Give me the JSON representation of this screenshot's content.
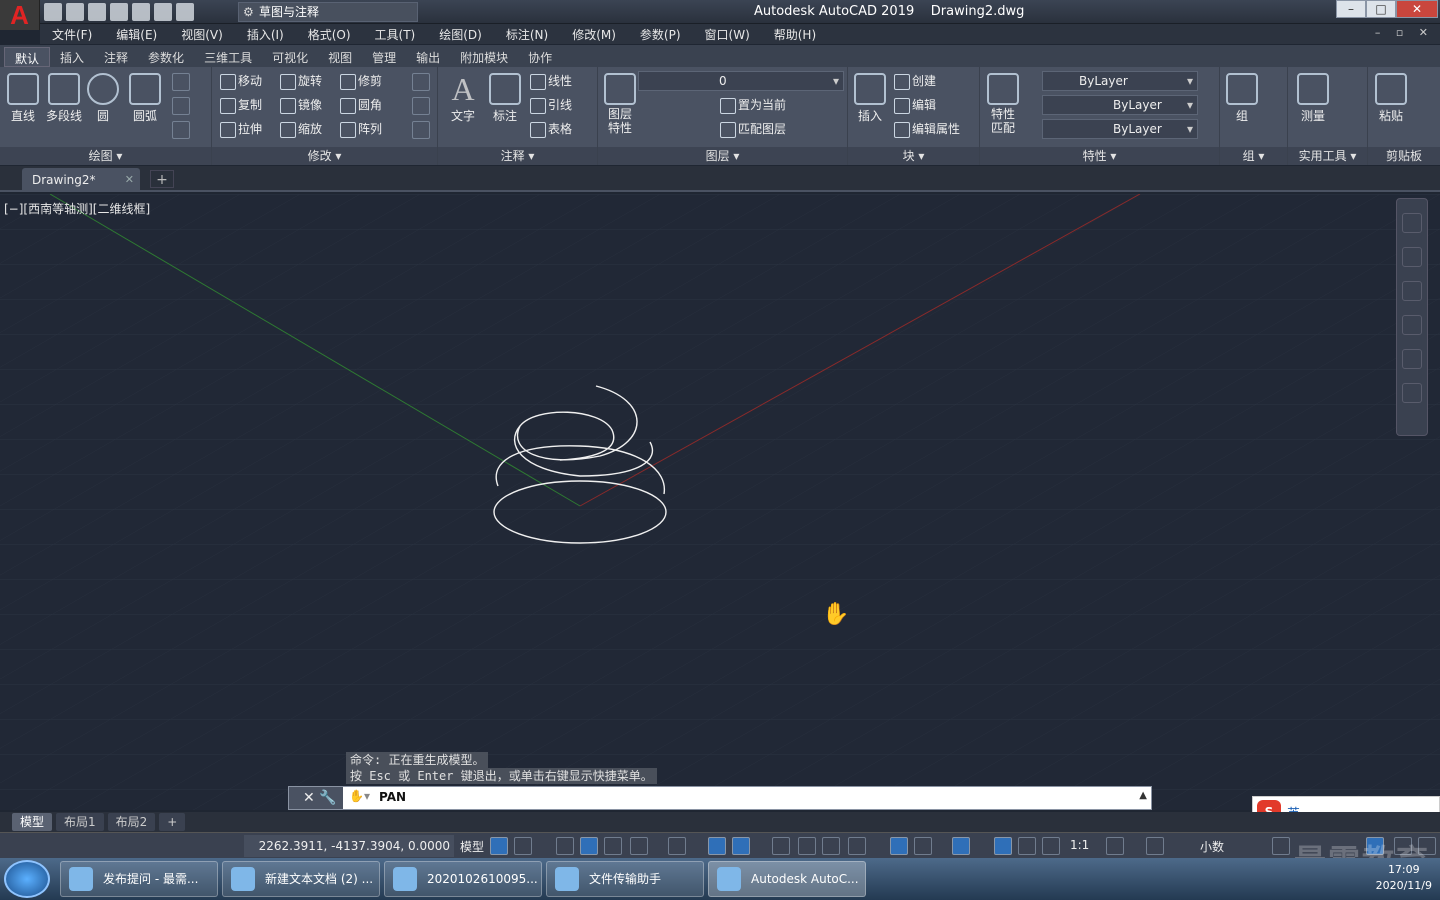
{
  "window": {
    "app_title": "Autodesk AutoCAD 2019",
    "doc_title": "Drawing2.dwg",
    "logo": "A",
    "workspace": "草图与注释"
  },
  "menus": [
    "文件(F)",
    "编辑(E)",
    "视图(V)",
    "插入(I)",
    "格式(O)",
    "工具(T)",
    "绘图(D)",
    "标注(N)",
    "修改(M)",
    "参数(P)",
    "窗口(W)",
    "帮助(H)"
  ],
  "ribbon_tabs": [
    "默认",
    "插入",
    "注释",
    "参数化",
    "三维工具",
    "可视化",
    "视图",
    "管理",
    "输出",
    "附加模块",
    "协作"
  ],
  "draw": {
    "title": "绘图 ▾",
    "line": "直线",
    "polyline": "多段线",
    "circle": "圆",
    "arc": "圆弧"
  },
  "modify": {
    "title": "修改 ▾",
    "move": "移动",
    "rotate": "旋转",
    "trim": "修剪",
    "copy": "复制",
    "mirror": "镜像",
    "fillet": "圆角",
    "stretch": "拉伸",
    "scale": "缩放",
    "array": "阵列"
  },
  "annotation": {
    "title": "注释 ▾",
    "text": "文字",
    "dimension": "标注",
    "linear": "线性",
    "leader": "引线",
    "table": "表格"
  },
  "layers": {
    "title": "图层 ▾",
    "properties": "图层\n特性",
    "current_layer": "0",
    "set_current": "置为当前",
    "match_layer": "匹配图层"
  },
  "block": {
    "title": "块 ▾",
    "insert": "插入",
    "create": "创建",
    "edit": "编辑",
    "edit_attr": "编辑属性"
  },
  "properties": {
    "title": "特性 ▾",
    "match": "特性\n匹配",
    "color": "ByLayer",
    "linetype": "ByLayer",
    "lineweight": "ByLayer"
  },
  "groups": {
    "title": "组 ▾",
    "group": "组"
  },
  "utilities": {
    "title": "实用工具 ▾",
    "measure": "测量"
  },
  "clipboard": {
    "title": "剪贴板",
    "paste": "粘贴"
  },
  "doc_tab": "Drawing2*",
  "viewport_label": "[−][西南等轴测][二维线框]",
  "history": [
    "命令: 正在重生成模型。",
    "按 Esc 或 Enter 键退出，或单击右键显示快捷菜单。"
  ],
  "command_input": "PAN",
  "layout_tabs": [
    "模型",
    "布局1",
    "布局2"
  ],
  "status": {
    "coords": "2262.3911, -4137.3904, 0.0000",
    "model": "模型",
    "scale": "1:1",
    "units": "小数"
  },
  "ime": {
    "lang": "英"
  },
  "taskbar": [
    {
      "label": "发布提问 - 最需..."
    },
    {
      "label": "新建文本文档 (2) ..."
    },
    {
      "label": "2020102610095..."
    },
    {
      "label": "文件传输助手"
    },
    {
      "label": "Autodesk AutoC..."
    }
  ],
  "clock": {
    "time": "17:09",
    "date": "2020/11/9"
  },
  "watermark": "最需教育",
  "colors": {
    "viewport": "#212836",
    "x_axis": "#8a2a2a",
    "y_axis": "#2a7a2a",
    "helix": "#f0f0f0"
  }
}
